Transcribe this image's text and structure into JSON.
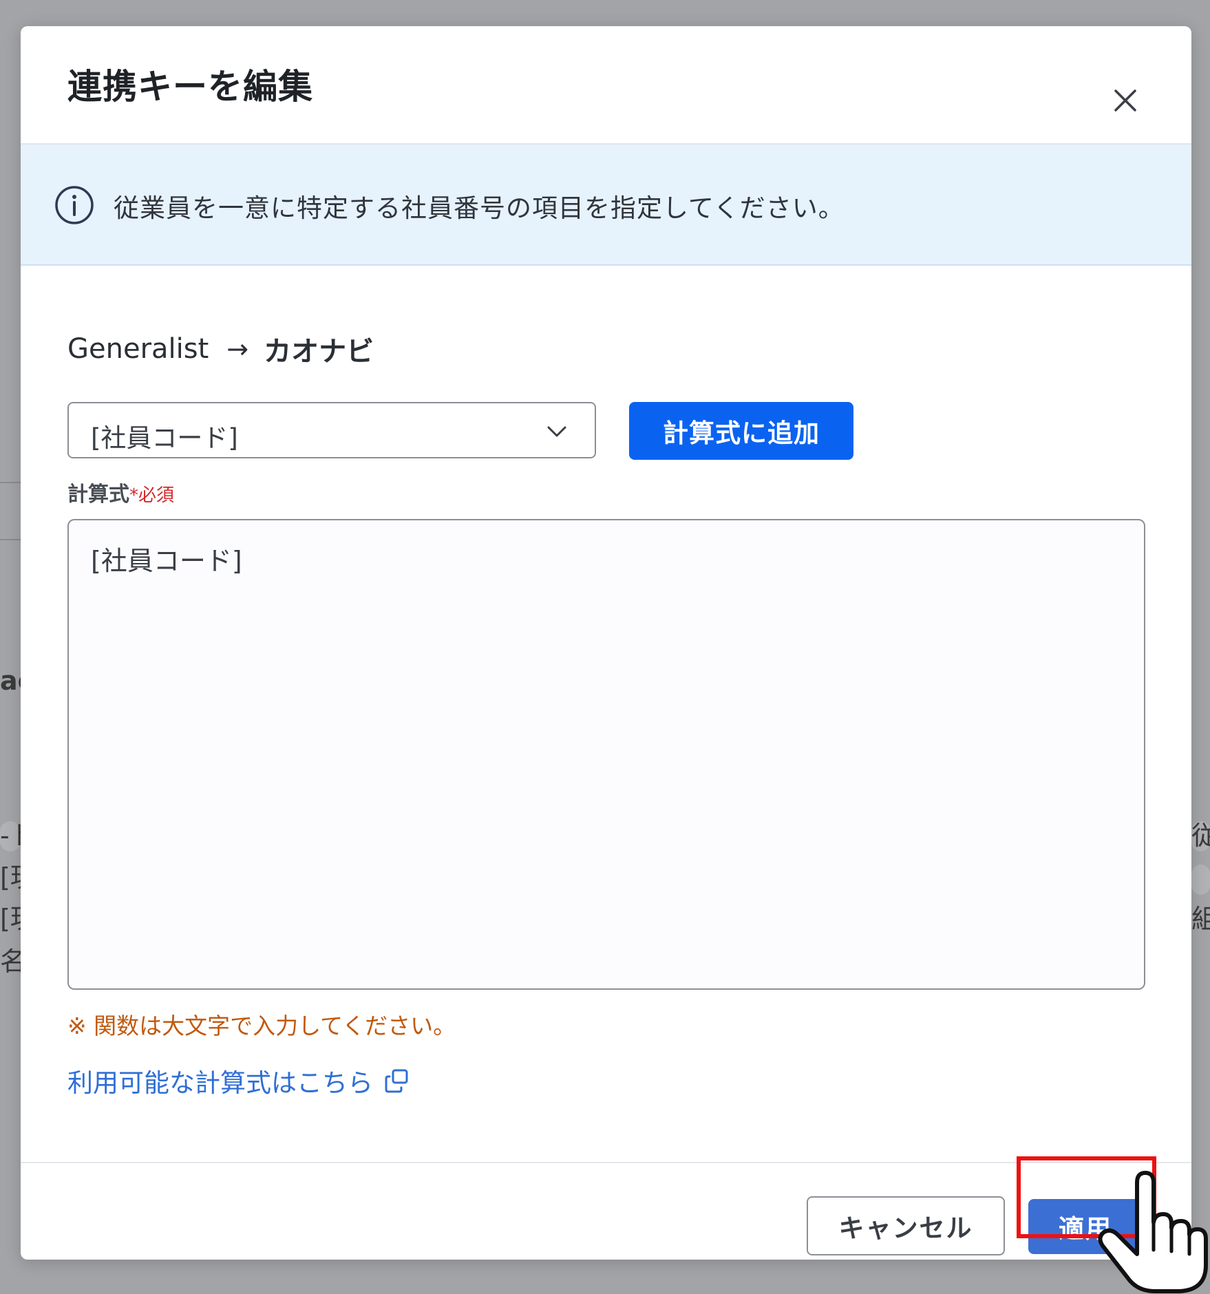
{
  "dialog": {
    "title": "連携キーを編集",
    "close_icon": "close-icon"
  },
  "info_banner": {
    "icon": "info-icon",
    "text": "従業員を一意に特定する社員番号の項目を指定してください。"
  },
  "mapping": {
    "source": "Generalist",
    "arrow": "→",
    "target": "カオナビ"
  },
  "field_select": {
    "value": "[社員コード]",
    "icon": "chevron-down-icon"
  },
  "add_button_label": "計算式に追加",
  "formula": {
    "label": "計算式",
    "required_mark": "*",
    "required_text": "必須",
    "value": "[社員コード]"
  },
  "note": "※ 関数は大文字で入力してください。",
  "help_link": {
    "label": "利用可能な計算式はこちら",
    "icon": "external-link-icon"
  },
  "footer": {
    "cancel_label": "キャンセル",
    "apply_label": "適用"
  },
  "background": {
    "fragments": [
      "ac",
      "-ト",
      "[現",
      "[現",
      "名",
      "従",
      "組"
    ]
  },
  "colors": {
    "primary": "#0a63f0",
    "apply": "#3c6fd4",
    "banner": "#e6f2fc",
    "required": "#d42a2a",
    "note": "#c05a10",
    "link": "#2f6fd6",
    "highlight": "#ee1111"
  }
}
